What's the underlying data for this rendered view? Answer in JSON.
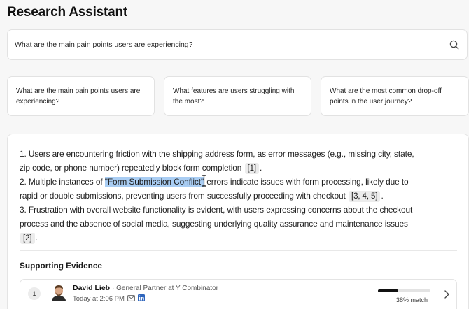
{
  "header": {
    "title": "Research Assistant"
  },
  "search": {
    "query": "What are the main pain points users are experiencing?"
  },
  "suggestions": [
    {
      "label": "What are the main pain points users are experiencing?"
    },
    {
      "label": "What features are users struggling with the most?"
    },
    {
      "label": "What are the most common drop-off points in the user journey?"
    }
  ],
  "answer": {
    "p1a": "1. Users are encountering friction with the shipping address form, as error messages (e.g., missing city, state,",
    "p1b": "zip code, or phone number) repeatedly block form completion",
    "p1_cite": "[1]",
    "p2a_pre": "2. Multiple instances of ",
    "p2a_hl": "\"Form Submission Conflict\"",
    "p2a_post": " errors indicate issues with form processing, likely due to",
    "p2b": "rapid or double submissions, preventing users from successfully proceeding with checkout",
    "p2_cite": "[3, 4, 5]",
    "p3a": "3. Frustration with overall website functionality is evident, with users expressing concerns about the checkout",
    "p3b": "process and the absence of social media, suggesting underlying quality assurance and maintenance issues",
    "p3_cite": "[2]",
    "period": "."
  },
  "evidence": {
    "section_title": "Supporting Evidence",
    "items": [
      {
        "index": "1",
        "name": "David Lieb",
        "role": "· General Partner at Y Combinator",
        "time": "Today at 2:06 PM",
        "match_label": "38% match",
        "match_fraction": 0.38
      }
    ]
  },
  "colors": {
    "highlight": "#a9cdf3",
    "linkedin": "#2d64bc"
  }
}
